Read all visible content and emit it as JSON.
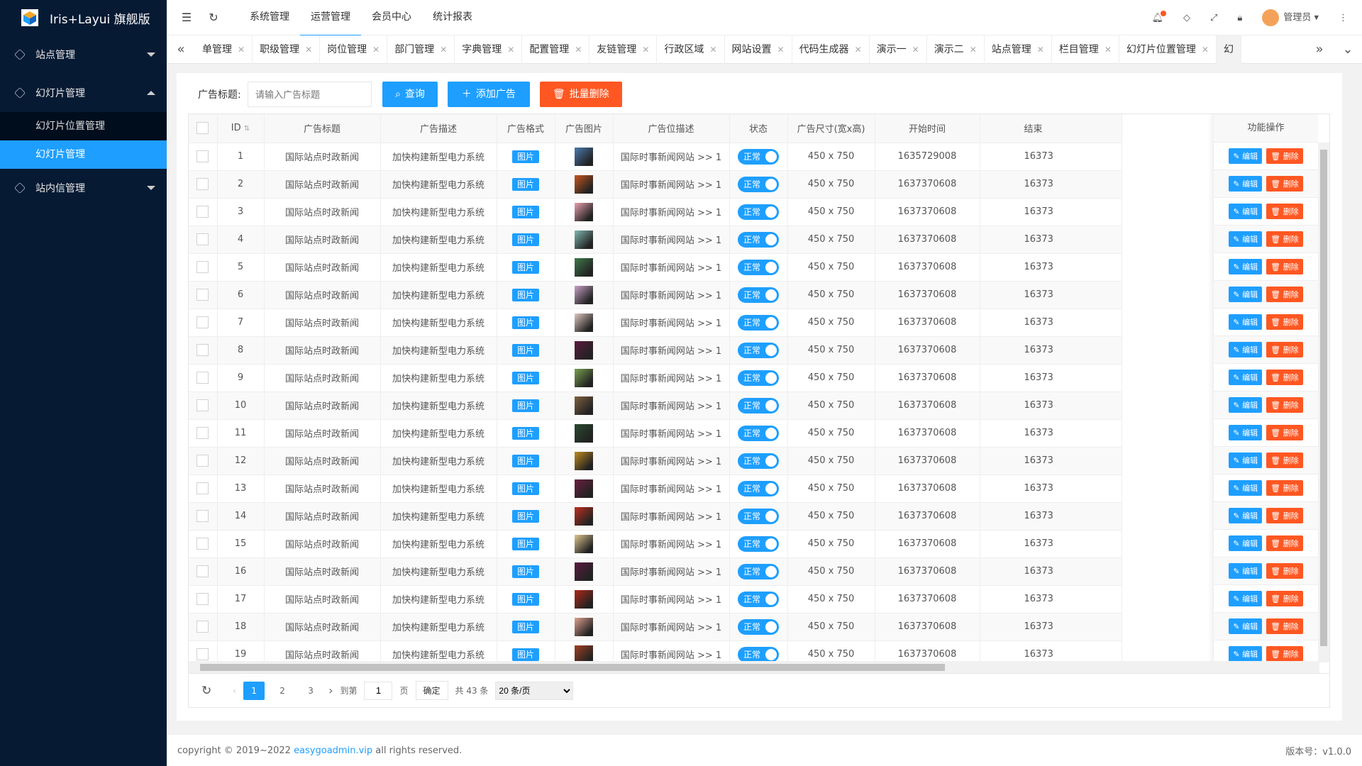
{
  "app": {
    "title": "Iris+Layui 旗舰版"
  },
  "sidebar": {
    "items": [
      {
        "label": "站点管理"
      },
      {
        "label": "幻灯片管理"
      },
      {
        "label": "站内信管理"
      }
    ],
    "sub": [
      {
        "label": "幻灯片位置管理"
      },
      {
        "label": "幻灯片管理"
      }
    ]
  },
  "topnav": [
    "系统管理",
    "运营管理",
    "会员中心",
    "统计报表"
  ],
  "user": {
    "name": "管理员"
  },
  "tabs": [
    "单管理",
    "职级管理",
    "岗位管理",
    "部门管理",
    "字典管理",
    "配置管理",
    "友链管理",
    "行政区域",
    "网站设置",
    "代码生成器",
    "演示一",
    "演示二",
    "站点管理",
    "栏目管理",
    "幻灯片位置管理",
    "幻"
  ],
  "search": {
    "label": "广告标题:",
    "placeholder": "请输入广告标题",
    "query": "查询",
    "add": "添加广告",
    "batch_delete": "批量删除"
  },
  "table": {
    "headers": [
      "ID",
      "广告标题",
      "广告描述",
      "广告格式",
      "广告图片",
      "广告位描述",
      "状态",
      "广告尺寸(宽x高)",
      "开始时间",
      "结束",
      "功能操作"
    ],
    "rows": [
      {
        "id": "1",
        "title": "国际站点时政新闻",
        "desc": "加快构建新型电力系统",
        "format": "图片",
        "pos": "国际时事新闻网站 >> 1",
        "status": "正常",
        "size": "450 x 750",
        "start": "1635729008",
        "end": "16373",
        "c": "#4a7bb0"
      },
      {
        "id": "2",
        "title": "国际站点时政新闻",
        "desc": "加快构建新型电力系统",
        "format": "图片",
        "pos": "国际时事新闻网站 >> 1",
        "status": "正常",
        "size": "450 x 750",
        "start": "1637370608",
        "end": "16373",
        "c": "#c8561e"
      },
      {
        "id": "3",
        "title": "国际站点时政新闻",
        "desc": "加快构建新型电力系统",
        "format": "图片",
        "pos": "国际时事新闻网站 >> 1",
        "status": "正常",
        "size": "450 x 750",
        "start": "1637370608",
        "end": "16373",
        "c": "#e8a0b0"
      },
      {
        "id": "4",
        "title": "国际站点时政新闻",
        "desc": "加快构建新型电力系统",
        "format": "图片",
        "pos": "国际时事新闻网站 >> 1",
        "status": "正常",
        "size": "450 x 750",
        "start": "1637370608",
        "end": "16373",
        "c": "#7fb8b0"
      },
      {
        "id": "5",
        "title": "国际站点时政新闻",
        "desc": "加快构建新型电力系统",
        "format": "图片",
        "pos": "国际时事新闻网站 >> 1",
        "status": "正常",
        "size": "450 x 750",
        "start": "1637370608",
        "end": "16373",
        "c": "#3d7a4a"
      },
      {
        "id": "6",
        "title": "国际站点时政新闻",
        "desc": "加快构建新型电力系统",
        "format": "图片",
        "pos": "国际时事新闻网站 >> 1",
        "status": "正常",
        "size": "450 x 750",
        "start": "1637370608",
        "end": "16373",
        "c": "#c9a0c8"
      },
      {
        "id": "7",
        "title": "国际站点时政新闻",
        "desc": "加快构建新型电力系统",
        "format": "图片",
        "pos": "国际时事新闻网站 >> 1",
        "status": "正常",
        "size": "450 x 750",
        "start": "1637370608",
        "end": "16373",
        "c": "#e0c8c0"
      },
      {
        "id": "8",
        "title": "国际站点时政新闻",
        "desc": "加快构建新型电力系统",
        "format": "图片",
        "pos": "国际时事新闻网站 >> 1",
        "status": "正常",
        "size": "450 x 750",
        "start": "1637370608",
        "end": "16373",
        "c": "#5a1a40"
      },
      {
        "id": "9",
        "title": "国际站点时政新闻",
        "desc": "加快构建新型电力系统",
        "format": "图片",
        "pos": "国际时事新闻网站 >> 1",
        "status": "正常",
        "size": "450 x 750",
        "start": "1637370608",
        "end": "16373",
        "c": "#7aa050"
      },
      {
        "id": "10",
        "title": "国际站点时政新闻",
        "desc": "加快构建新型电力系统",
        "format": "图片",
        "pos": "国际时事新闻网站 >> 1",
        "status": "正常",
        "size": "450 x 750",
        "start": "1637370608",
        "end": "16373",
        "c": "#806040"
      },
      {
        "id": "11",
        "title": "国际站点时政新闻",
        "desc": "加快构建新型电力系统",
        "format": "图片",
        "pos": "国际时事新闻网站 >> 1",
        "status": "正常",
        "size": "450 x 750",
        "start": "1637370608",
        "end": "16373",
        "c": "#2a4a30"
      },
      {
        "id": "12",
        "title": "国际站点时政新闻",
        "desc": "加快构建新型电力系统",
        "format": "图片",
        "pos": "国际时事新闻网站 >> 1",
        "status": "正常",
        "size": "450 x 750",
        "start": "1637370608",
        "end": "16373",
        "c": "#c08a20"
      },
      {
        "id": "13",
        "title": "国际站点时政新闻",
        "desc": "加快构建新型电力系统",
        "format": "图片",
        "pos": "国际时事新闻网站 >> 1",
        "status": "正常",
        "size": "450 x 750",
        "start": "1637370608",
        "end": "16373",
        "c": "#6a2040"
      },
      {
        "id": "14",
        "title": "国际站点时政新闻",
        "desc": "加快构建新型电力系统",
        "format": "图片",
        "pos": "国际时事新闻网站 >> 1",
        "status": "正常",
        "size": "450 x 750",
        "start": "1637370608",
        "end": "16373",
        "c": "#c03020"
      },
      {
        "id": "15",
        "title": "国际站点时政新闻",
        "desc": "加快构建新型电力系统",
        "format": "图片",
        "pos": "国际时事新闻网站 >> 1",
        "status": "正常",
        "size": "450 x 750",
        "start": "1637370608",
        "end": "16373",
        "c": "#e0c890"
      },
      {
        "id": "16",
        "title": "国际站点时政新闻",
        "desc": "加快构建新型电力系统",
        "format": "图片",
        "pos": "国际时事新闻网站 >> 1",
        "status": "正常",
        "size": "450 x 750",
        "start": "1637370608",
        "end": "16373",
        "c": "#5a1a40"
      },
      {
        "id": "17",
        "title": "国际站点时政新闻",
        "desc": "加快构建新型电力系统",
        "format": "图片",
        "pos": "国际时事新闻网站 >> 1",
        "status": "正常",
        "size": "450 x 750",
        "start": "1637370608",
        "end": "16373",
        "c": "#b02818"
      },
      {
        "id": "18",
        "title": "国际站点时政新闻",
        "desc": "加快构建新型电力系统",
        "format": "图片",
        "pos": "国际时事新闻网站 >> 1",
        "status": "正常",
        "size": "450 x 750",
        "start": "1637370608",
        "end": "16373",
        "c": "#e0a090"
      },
      {
        "id": "19",
        "title": "国际站点时政新闻",
        "desc": "加快构建新型电力系统",
        "format": "图片",
        "pos": "国际时事新闻网站 >> 1",
        "status": "正常",
        "size": "450 x 750",
        "start": "1637370608",
        "end": "16373",
        "c": "#a04020"
      }
    ],
    "edit": "编辑",
    "delete": "删除"
  },
  "pager": {
    "pages": [
      "1",
      "2",
      "3"
    ],
    "goto": "到第",
    "page_input": "1",
    "page_unit": "页",
    "confirm": "确定",
    "total": "共 43 条",
    "per_page": "20 条/页"
  },
  "footer": {
    "copyright_pre": "copyright © 2019~2022 ",
    "link": "easygoadmin.vip",
    "copyright_post": " all rights reserved.",
    "version": "版本号：v1.0.0"
  },
  "colors": {
    "primary": "#1e9fff",
    "danger": "#ff5722",
    "sidebar": "#061a33"
  }
}
